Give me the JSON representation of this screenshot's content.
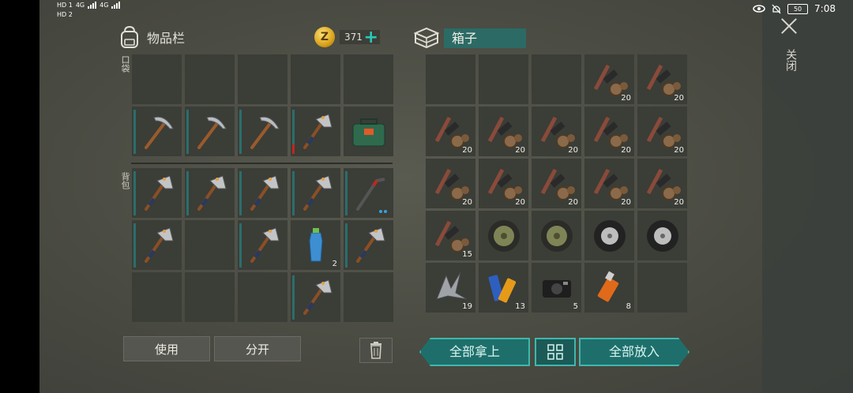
{
  "status": {
    "network_1": "HD 1",
    "network_2": "HD 2",
    "net_type": "4G",
    "battery": "50",
    "time": "7:08"
  },
  "inventory": {
    "title": "物品栏",
    "coins": "371",
    "pocket_label": "口袋",
    "backpack_label": "背包",
    "pocket_slots": [
      {
        "item": "empty"
      },
      {
        "item": "empty"
      },
      {
        "item": "empty"
      },
      {
        "item": "empty"
      },
      {
        "item": "empty"
      },
      {
        "item": "pickaxe"
      },
      {
        "item": "pickaxe"
      },
      {
        "item": "pickaxe"
      },
      {
        "item": "hatchet",
        "durability": "low"
      },
      {
        "item": "toolbox"
      }
    ],
    "backpack_slots": [
      {
        "item": "hatchet"
      },
      {
        "item": "hatchet"
      },
      {
        "item": "hatchet"
      },
      {
        "item": "hatchet"
      },
      {
        "item": "crowbar"
      },
      {
        "item": "hatchet"
      },
      {
        "item": "empty"
      },
      {
        "item": "hatchet"
      },
      {
        "item": "water-bottle",
        "count": "2"
      },
      {
        "item": "hatchet"
      },
      {
        "item": "empty"
      },
      {
        "item": "empty"
      },
      {
        "item": "empty"
      },
      {
        "item": "hatchet"
      },
      {
        "item": "empty"
      }
    ],
    "use_button": "使用",
    "split_button": "分开"
  },
  "box": {
    "title": "箱子",
    "slots": [
      {
        "item": "empty"
      },
      {
        "item": "empty"
      },
      {
        "item": "empty"
      },
      {
        "item": "pipe-parts",
        "count": "20"
      },
      {
        "item": "pipe-parts",
        "count": "20"
      },
      {
        "item": "pipe-parts",
        "count": "20"
      },
      {
        "item": "pipe-parts",
        "count": "20"
      },
      {
        "item": "pipe-parts",
        "count": "20"
      },
      {
        "item": "pipe-parts",
        "count": "20"
      },
      {
        "item": "pipe-parts",
        "count": "20"
      },
      {
        "item": "pipe-parts",
        "count": "20"
      },
      {
        "item": "pipe-parts",
        "count": "20"
      },
      {
        "item": "pipe-parts",
        "count": "20"
      },
      {
        "item": "pipe-parts",
        "count": "20"
      },
      {
        "item": "pipe-parts",
        "count": "20"
      },
      {
        "item": "pipe-parts",
        "count": "15"
      },
      {
        "item": "green-wheel"
      },
      {
        "item": "green-wheel"
      },
      {
        "item": "grey-tire"
      },
      {
        "item": "grey-tire"
      },
      {
        "item": "scrap-metal",
        "count": "19"
      },
      {
        "item": "batteries",
        "count": "13"
      },
      {
        "item": "camera",
        "count": "5"
      },
      {
        "item": "usb-stick",
        "count": "8"
      },
      {
        "item": "empty"
      }
    ],
    "take_all_button": "全部拿上",
    "put_all_button": "全部放入"
  },
  "close_label": "关闭",
  "colors": {
    "accent": "#1e6f6b",
    "accent_border": "#3fb7ac",
    "slot": "#3b3d37",
    "plus": "#27c9b8"
  }
}
